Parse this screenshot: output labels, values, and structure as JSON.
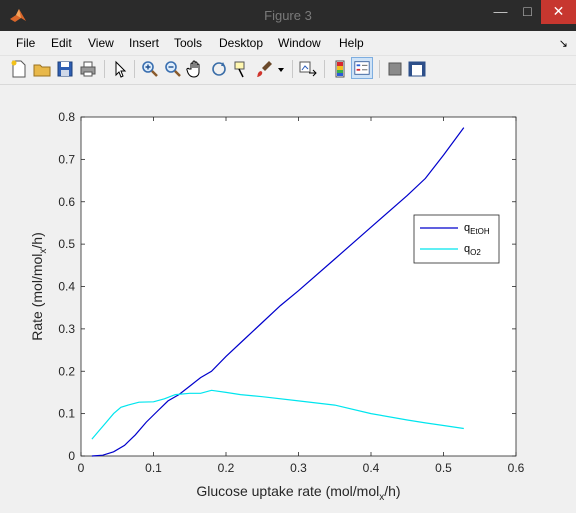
{
  "window": {
    "title": "Figure 3",
    "minimize_glyph": "—",
    "maximize_glyph": "□",
    "close_glyph": "✕"
  },
  "menu": {
    "items": [
      "File",
      "Edit",
      "View",
      "Insert",
      "Tools",
      "Desktop",
      "Window",
      "Help"
    ],
    "dock_glyph": "↘"
  },
  "toolbar": {
    "icons": [
      "new-figure-icon",
      "open-file-icon",
      "save-icon",
      "print-icon",
      "edit-plot-arrow-icon",
      "zoom-in-icon",
      "zoom-out-icon",
      "pan-hand-icon",
      "rotate-3d-icon",
      "data-cursor-icon",
      "brush-icon",
      "brush-dropdown-icon",
      "link-plot-icon",
      "colorbar-icon",
      "legend-icon",
      "hide-plot-tools-icon",
      "show-plot-tools-icon"
    ],
    "active": "legend-icon"
  },
  "chart_data": {
    "type": "line",
    "xlabel_main": "Glucose uptake rate (mol/mol",
    "xlabel_sub": "x",
    "xlabel_tail": "/h)",
    "ylabel_main": "Rate (mol/mol",
    "ylabel_sub": "x",
    "ylabel_tail": "/h)",
    "xlim": [
      0,
      0.6
    ],
    "ylim": [
      0,
      0.8
    ],
    "xticks": [
      "0",
      "0.1",
      "0.2",
      "0.3",
      "0.4",
      "0.5",
      "0.6"
    ],
    "yticks": [
      "0",
      "0.1",
      "0.2",
      "0.3",
      "0.4",
      "0.5",
      "0.6",
      "0.7",
      "0.8"
    ],
    "legend_position": "right",
    "series": [
      {
        "name_main": "q",
        "name_sub": "EtOH",
        "color": "#0000cc",
        "x": [
          0.015,
          0.03,
          0.045,
          0.06,
          0.075,
          0.09,
          0.105,
          0.12,
          0.135,
          0.15,
          0.165,
          0.18,
          0.2,
          0.225,
          0.25,
          0.275,
          0.3,
          0.35,
          0.4,
          0.45,
          0.475,
          0.5,
          0.528
        ],
        "y": [
          0.0,
          0.002,
          0.01,
          0.025,
          0.05,
          0.08,
          0.105,
          0.13,
          0.145,
          0.165,
          0.185,
          0.2,
          0.235,
          0.275,
          0.315,
          0.355,
          0.39,
          0.465,
          0.54,
          0.615,
          0.655,
          0.71,
          0.775
        ]
      },
      {
        "name_main": "q",
        "name_sub": "O2",
        "color": "#00e5ee",
        "x": [
          0.015,
          0.025,
          0.035,
          0.045,
          0.055,
          0.065,
          0.08,
          0.1,
          0.115,
          0.13,
          0.15,
          0.165,
          0.18,
          0.2,
          0.22,
          0.25,
          0.3,
          0.35,
          0.4,
          0.45,
          0.475,
          0.5,
          0.528
        ],
        "y": [
          0.04,
          0.06,
          0.08,
          0.1,
          0.115,
          0.12,
          0.127,
          0.128,
          0.135,
          0.145,
          0.148,
          0.148,
          0.155,
          0.15,
          0.145,
          0.14,
          0.13,
          0.12,
          0.1,
          0.085,
          0.078,
          0.072,
          0.065
        ]
      }
    ]
  }
}
